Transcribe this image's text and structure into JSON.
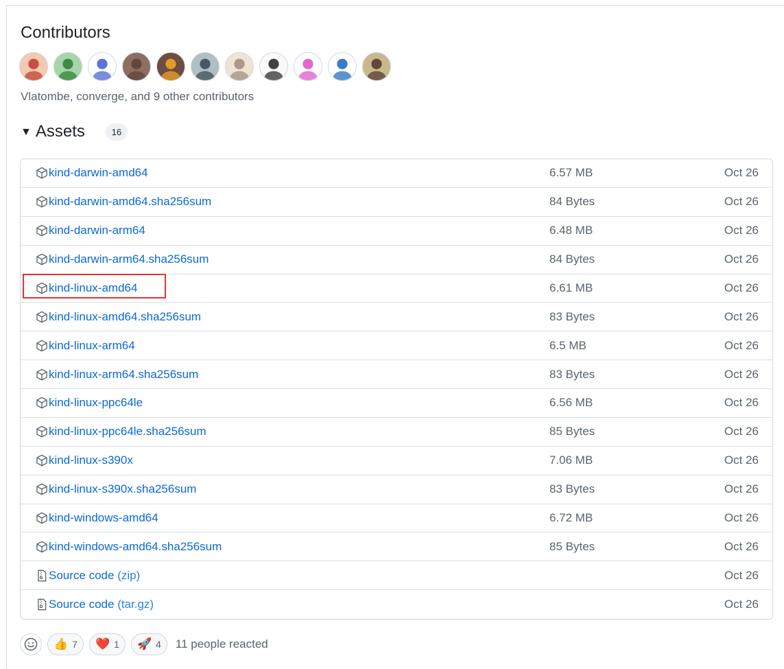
{
  "contributors": {
    "title": "Contributors",
    "summary": "Vlatombe, converge, and 9 other contributors",
    "avatars": [
      {
        "color": "#c0392b",
        "bg": "#f3c9b0"
      },
      {
        "color": "#2e7d32",
        "bg": "#a5d6a7"
      },
      {
        "color": "#3f5ccf",
        "bg": "#ffffff"
      },
      {
        "color": "#5d4037",
        "bg": "#8d6e63"
      },
      {
        "color": "#f9a825",
        "bg": "#6d4c41"
      },
      {
        "color": "#37474f",
        "bg": "#b0bec5"
      },
      {
        "color": "#a1887f",
        "bg": "#efe3d3"
      },
      {
        "color": "#212121",
        "bg": "#fafafa"
      },
      {
        "color": "#d94fc8",
        "bg": "#ffffff"
      },
      {
        "color": "#1565c0",
        "bg": "#ffffff"
      },
      {
        "color": "#4e342e",
        "bg": "#c9b98a"
      }
    ]
  },
  "assets": {
    "title": "Assets",
    "count": "16",
    "items": [
      {
        "name": "kind-darwin-amd64",
        "suffix": "",
        "size": "6.57 MB",
        "date": "Oct 26",
        "type": "package"
      },
      {
        "name": "kind-darwin-amd64.sha256sum",
        "suffix": "",
        "size": "84 Bytes",
        "date": "Oct 26",
        "type": "package"
      },
      {
        "name": "kind-darwin-arm64",
        "suffix": "",
        "size": "6.48 MB",
        "date": "Oct 26",
        "type": "package"
      },
      {
        "name": "kind-darwin-arm64.sha256sum",
        "suffix": "",
        "size": "84 Bytes",
        "date": "Oct 26",
        "type": "package"
      },
      {
        "name": "kind-linux-amd64",
        "suffix": "",
        "size": "6.61 MB",
        "date": "Oct 26",
        "type": "package"
      },
      {
        "name": "kind-linux-amd64.sha256sum",
        "suffix": "",
        "size": "83 Bytes",
        "date": "Oct 26",
        "type": "package"
      },
      {
        "name": "kind-linux-arm64",
        "suffix": "",
        "size": "6.5 MB",
        "date": "Oct 26",
        "type": "package"
      },
      {
        "name": "kind-linux-arm64.sha256sum",
        "suffix": "",
        "size": "83 Bytes",
        "date": "Oct 26",
        "type": "package"
      },
      {
        "name": "kind-linux-ppc64le",
        "suffix": "",
        "size": "6.56 MB",
        "date": "Oct 26",
        "type": "package"
      },
      {
        "name": "kind-linux-ppc64le.sha256sum",
        "suffix": "",
        "size": "85 Bytes",
        "date": "Oct 26",
        "type": "package"
      },
      {
        "name": "kind-linux-s390x",
        "suffix": "",
        "size": "7.06 MB",
        "date": "Oct 26",
        "type": "package"
      },
      {
        "name": "kind-linux-s390x.sha256sum",
        "suffix": "",
        "size": "83 Bytes",
        "date": "Oct 26",
        "type": "package"
      },
      {
        "name": "kind-windows-amd64",
        "suffix": "",
        "size": "6.72 MB",
        "date": "Oct 26",
        "type": "package"
      },
      {
        "name": "kind-windows-amd64.sha256sum",
        "suffix": "",
        "size": "85 Bytes",
        "date": "Oct 26",
        "type": "package"
      },
      {
        "name": "Source code",
        "suffix": "(zip)",
        "size": "",
        "date": "Oct 26",
        "type": "zip"
      },
      {
        "name": "Source code",
        "suffix": "(tar.gz)",
        "size": "",
        "date": "Oct 26",
        "type": "zip"
      }
    ]
  },
  "reactions": {
    "items": [
      {
        "emoji": "👍",
        "count": "7",
        "icon": "thumbs-up-icon"
      },
      {
        "emoji": "❤️",
        "count": "1",
        "icon": "heart-icon"
      },
      {
        "emoji": "🚀",
        "count": "4",
        "icon": "rocket-icon"
      }
    ],
    "summary": "11 people reacted"
  },
  "highlight_color": "#e5322d",
  "link_color": "#0969da"
}
